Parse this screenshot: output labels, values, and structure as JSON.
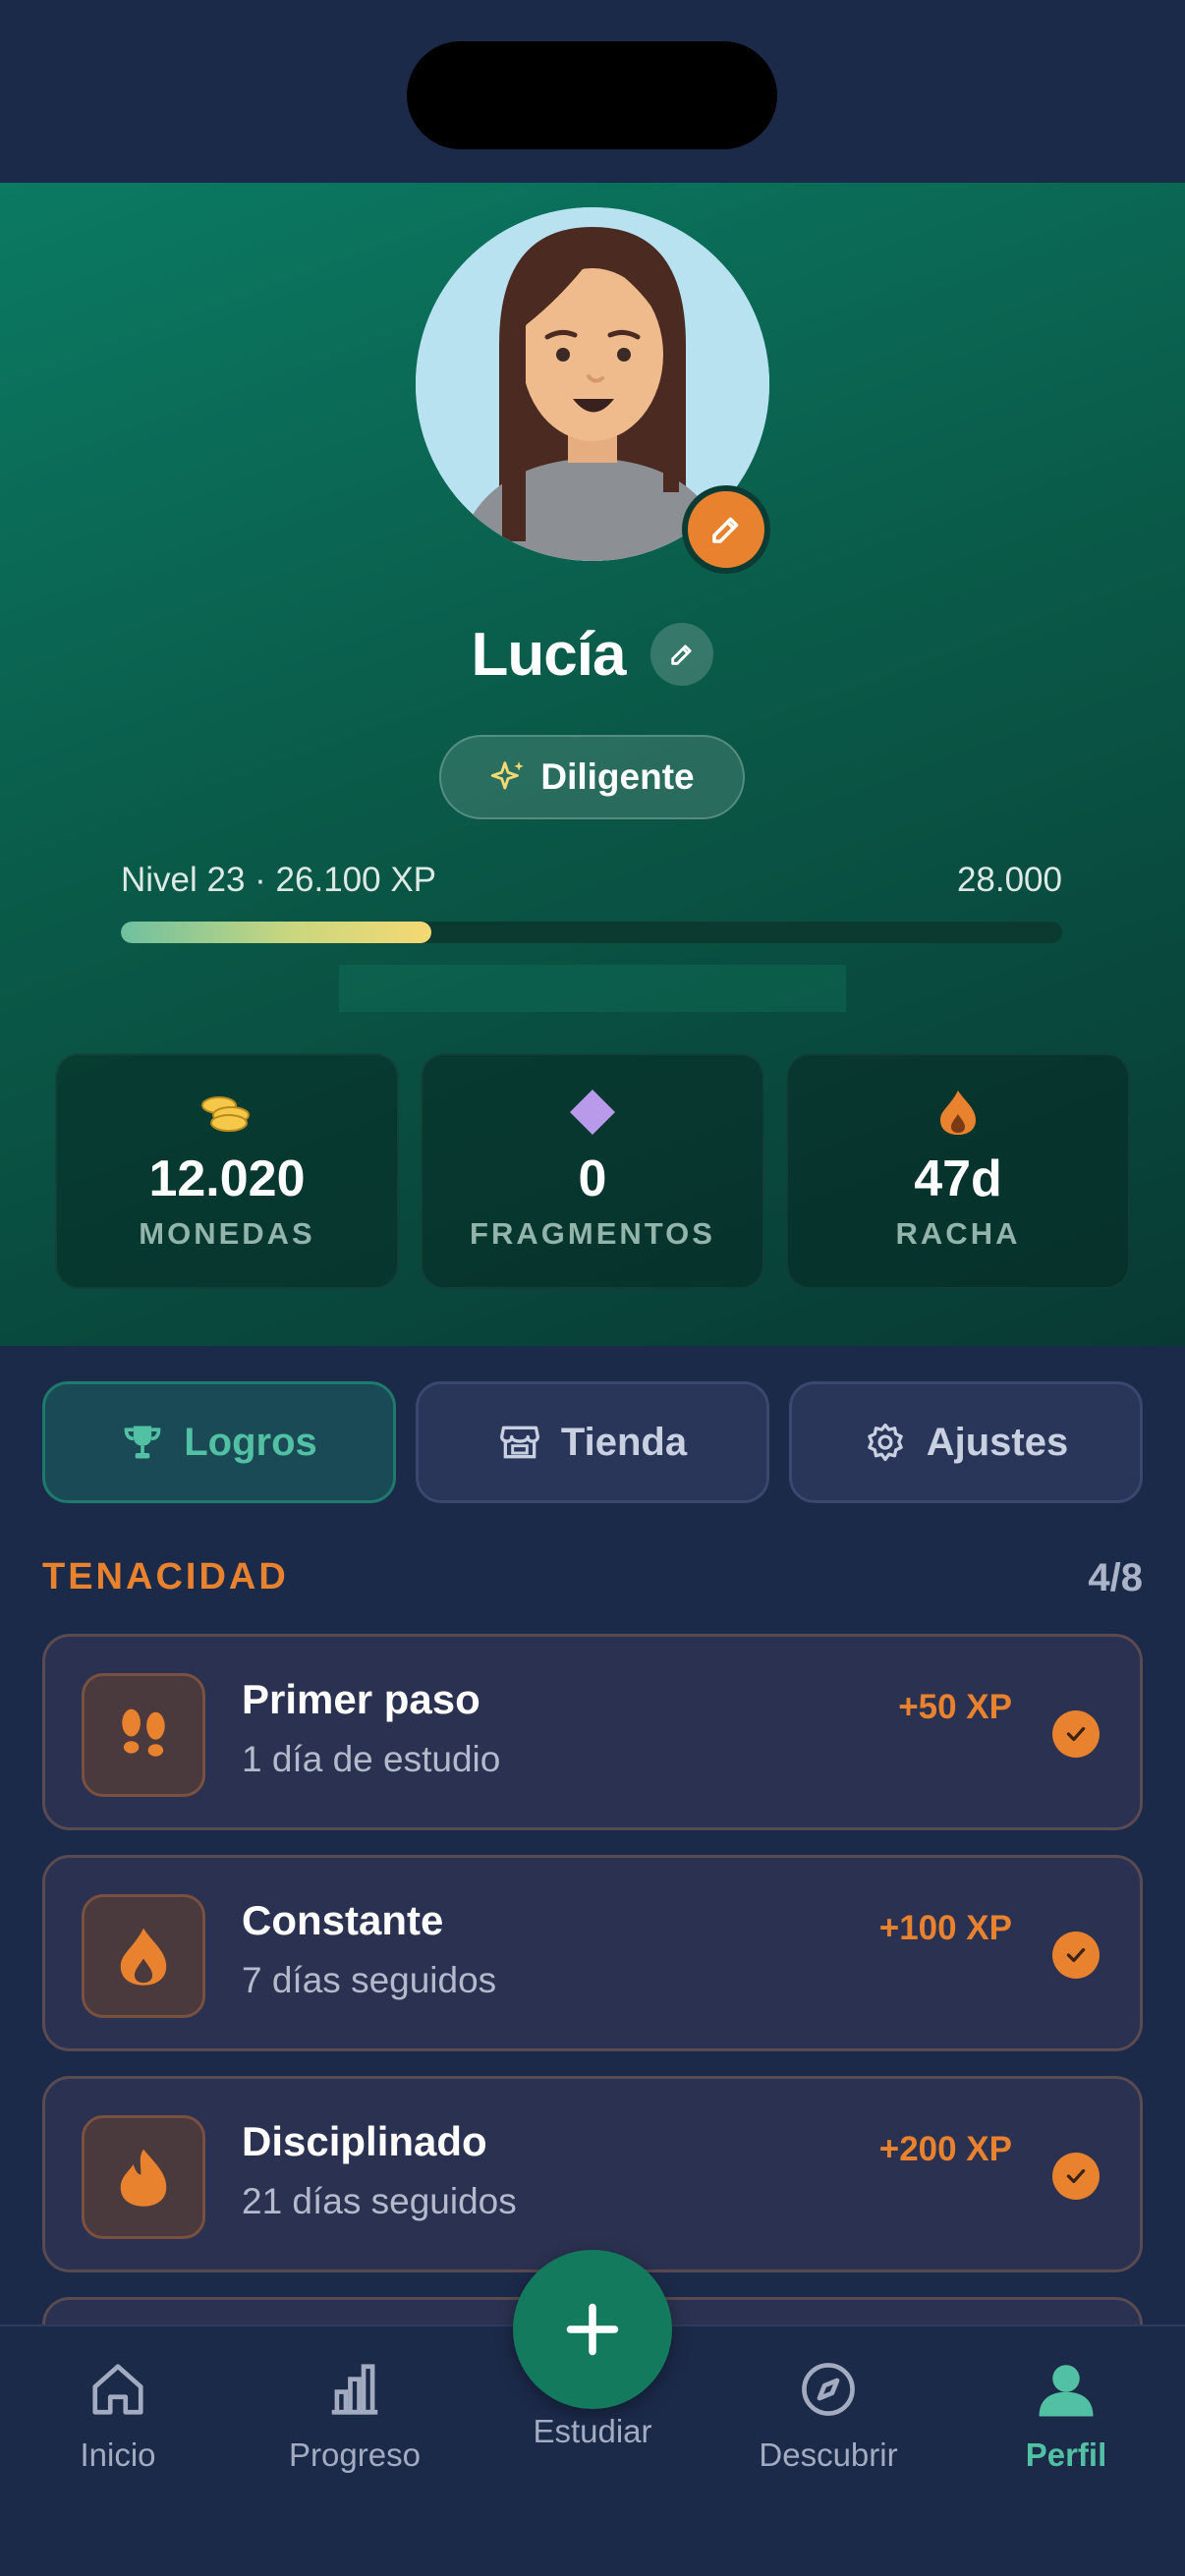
{
  "profile": {
    "name": "Lucía",
    "title": "Diligente",
    "level_text": "Nivel 23 · 26.100 XP",
    "level_max": "28.000",
    "xp_progress": 0.33
  },
  "stats": [
    {
      "icon": "coins-icon",
      "value": "12.020",
      "label": "MONEDAS"
    },
    {
      "icon": "diamond-icon",
      "value": "0",
      "label": "FRAGMENTOS"
    },
    {
      "icon": "flame-icon",
      "value": "47d",
      "label": "RACHA"
    }
  ],
  "tabs": [
    {
      "label": "Logros",
      "icon": "trophy-icon",
      "active": true
    },
    {
      "label": "Tienda",
      "icon": "store-icon",
      "active": false
    },
    {
      "label": "Ajustes",
      "icon": "gear-icon",
      "active": false
    }
  ],
  "section": {
    "title": "TENACIDAD",
    "count": "4/8"
  },
  "achievements": [
    {
      "title": "Primer paso",
      "desc": "1 día de estudio",
      "xp": "+50 XP",
      "icon": "footprints-icon",
      "done": true
    },
    {
      "title": "Constante",
      "desc": "7 días seguidos",
      "xp": "+100 XP",
      "icon": "flame-icon",
      "done": true
    },
    {
      "title": "Disciplinado",
      "desc": "21 días seguidos",
      "xp": "+200 XP",
      "icon": "flame-icon",
      "done": true
    }
  ],
  "nav": {
    "inicio": "Inicio",
    "progreso": "Progreso",
    "estudiar": "Estudiar",
    "descubrir": "Descubrir",
    "perfil": "Perfil"
  },
  "colors": {
    "accent": "#e8822f",
    "teal": "#52c0a2",
    "background": "#1c2a4a",
    "hero": "#0a5b49"
  }
}
